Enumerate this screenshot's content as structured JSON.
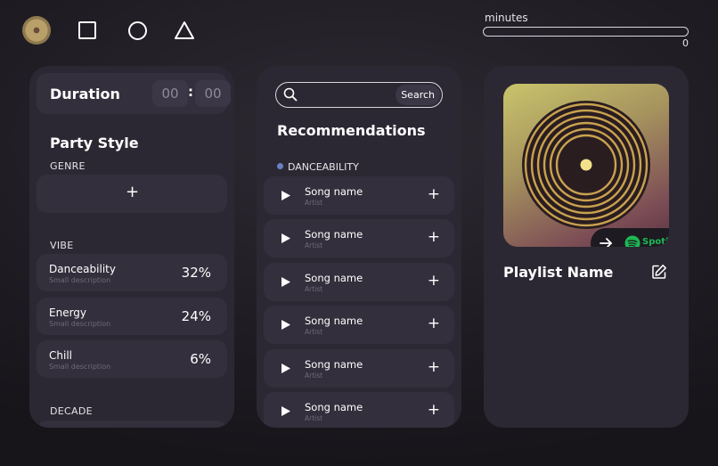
{
  "nav": {
    "icons": [
      "vinyl-logo-icon",
      "square-icon",
      "circle-icon",
      "triangle-icon"
    ]
  },
  "minutes": {
    "label": "minutes",
    "value": "0",
    "fraction": 0
  },
  "duration": {
    "title": "Duration",
    "hours": "00",
    "minutes": "00",
    "separator": ":"
  },
  "party_style": {
    "title": "Party Style",
    "genre_label": "GENRE",
    "add_symbol": "+",
    "vibe_label": "VIBE",
    "vibes": [
      {
        "name": "Danceability",
        "description": "Small description",
        "value": "32%"
      },
      {
        "name": "Energy",
        "description": "Small description",
        "value": "24%"
      },
      {
        "name": "Chill",
        "description": "Small description",
        "value": "6%"
      }
    ],
    "decade_label": "DECADE"
  },
  "recommendations": {
    "search_placeholder": "",
    "search_button": "Search",
    "title": "Recommendations",
    "filter_label": "DANCEABILITY",
    "filter_color": "#6b7fc5",
    "add_symbol": "+",
    "songs": [
      {
        "name": "Song name",
        "artist": "Artist"
      },
      {
        "name": "Song name",
        "artist": "Artist"
      },
      {
        "name": "Song name",
        "artist": "Artist"
      },
      {
        "name": "Song name",
        "artist": "Artist"
      },
      {
        "name": "Song name",
        "artist": "Artist"
      },
      {
        "name": "Song name",
        "artist": "Artist"
      }
    ]
  },
  "playlist": {
    "name": "Playlist Name",
    "spotify_label": "Spotify",
    "spotify_color": "#1db954"
  },
  "colors": {
    "background": "#1f1c23",
    "panel": "#2c2833",
    "card": "#342f3c"
  }
}
